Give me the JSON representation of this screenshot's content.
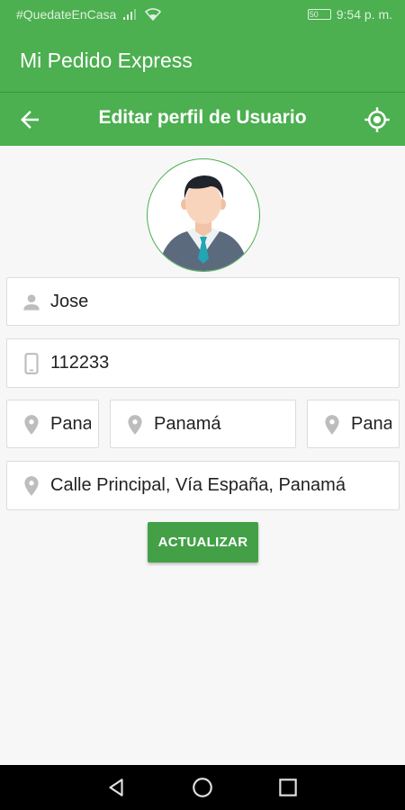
{
  "status_bar": {
    "carrier_text": "#QuedateEnCasa",
    "time": "9:54 p. m.",
    "battery_level": "50"
  },
  "app": {
    "title": "Mi Pedido Express"
  },
  "toolbar": {
    "title": "Editar perfil de Usuario",
    "back_icon": "arrow-back-icon",
    "location_icon": "my-location-icon"
  },
  "form": {
    "name": "Jose",
    "phone": "112233",
    "province": "Panamá",
    "city": "Panamá",
    "district": "Panamá",
    "address": "Calle Principal, Vía España, Panamá",
    "submit_label": "ACTUALIZAR"
  },
  "colors": {
    "primary": "#4caf50",
    "button": "#43a047",
    "icon_gray": "#bdbdbd"
  }
}
